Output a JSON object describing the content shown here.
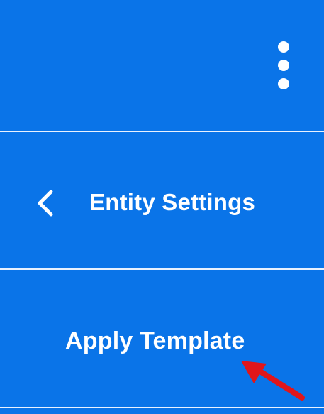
{
  "header": {
    "more_menu_icon": "kebab-vertical-icon"
  },
  "navigation": {
    "back_icon": "chevron-left-icon",
    "title": "Entity Settings"
  },
  "actions": {
    "apply_template_label": "Apply Template"
  },
  "annotation": {
    "arrow_icon": "red-arrow-icon",
    "arrow_color": "#e0161b"
  },
  "colors": {
    "background": "#0a74e8",
    "text": "#ffffff",
    "divider": "#e9f2ff"
  }
}
